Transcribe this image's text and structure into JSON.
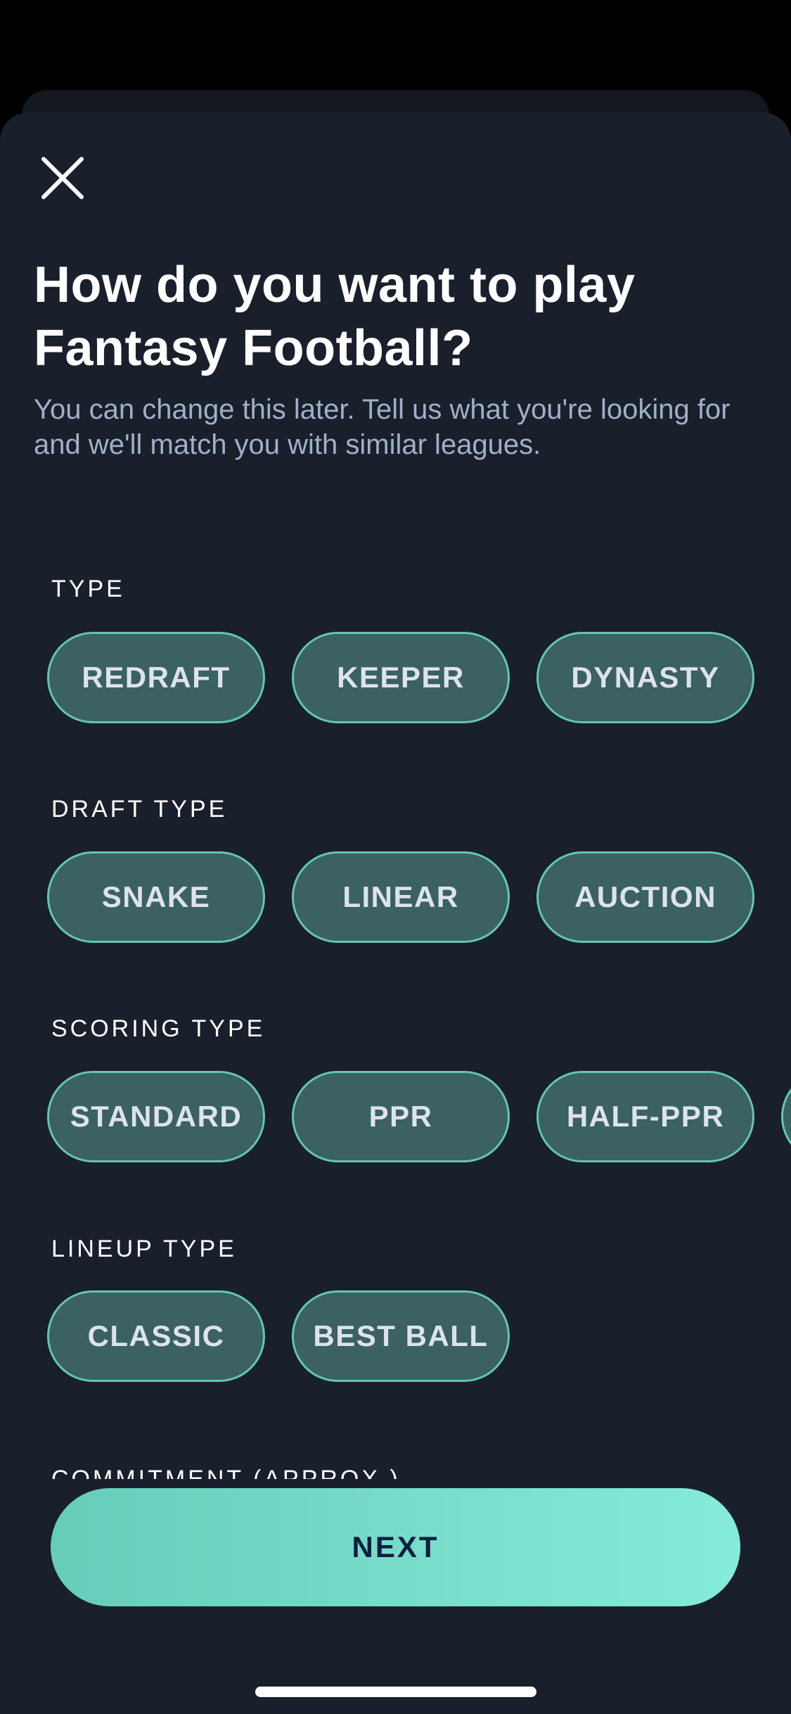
{
  "header": {
    "close_icon": "close-icon",
    "title": "How do you want to play Fantasy Football?",
    "subtitle": "You can change this later. Tell us what you're looking for and we'll match you with similar leagues."
  },
  "sections": [
    {
      "label": "TYPE",
      "options": [
        "REDRAFT",
        "KEEPER",
        "DYNASTY"
      ]
    },
    {
      "label": "DRAFT TYPE",
      "options": [
        "SNAKE",
        "LINEAR",
        "AUCTION"
      ]
    },
    {
      "label": "SCORING TYPE",
      "options": [
        "STANDARD",
        "PPR",
        "HALF-PPR",
        ""
      ]
    },
    {
      "label": "LINEUP TYPE",
      "options": [
        "CLASSIC",
        "BEST BALL"
      ]
    },
    {
      "label": "COMMITMENT (APPROX.)",
      "options": []
    }
  ],
  "footer": {
    "next_label": "NEXT"
  },
  "colors": {
    "background": "#1a1f2c",
    "pill_fill": "#3b6162",
    "pill_border": "#62c7b2",
    "accent_start": "#67cdb9",
    "accent_end": "#86ecda",
    "next_text": "#0c1f3f",
    "subtitle": "#9fb0c8"
  }
}
